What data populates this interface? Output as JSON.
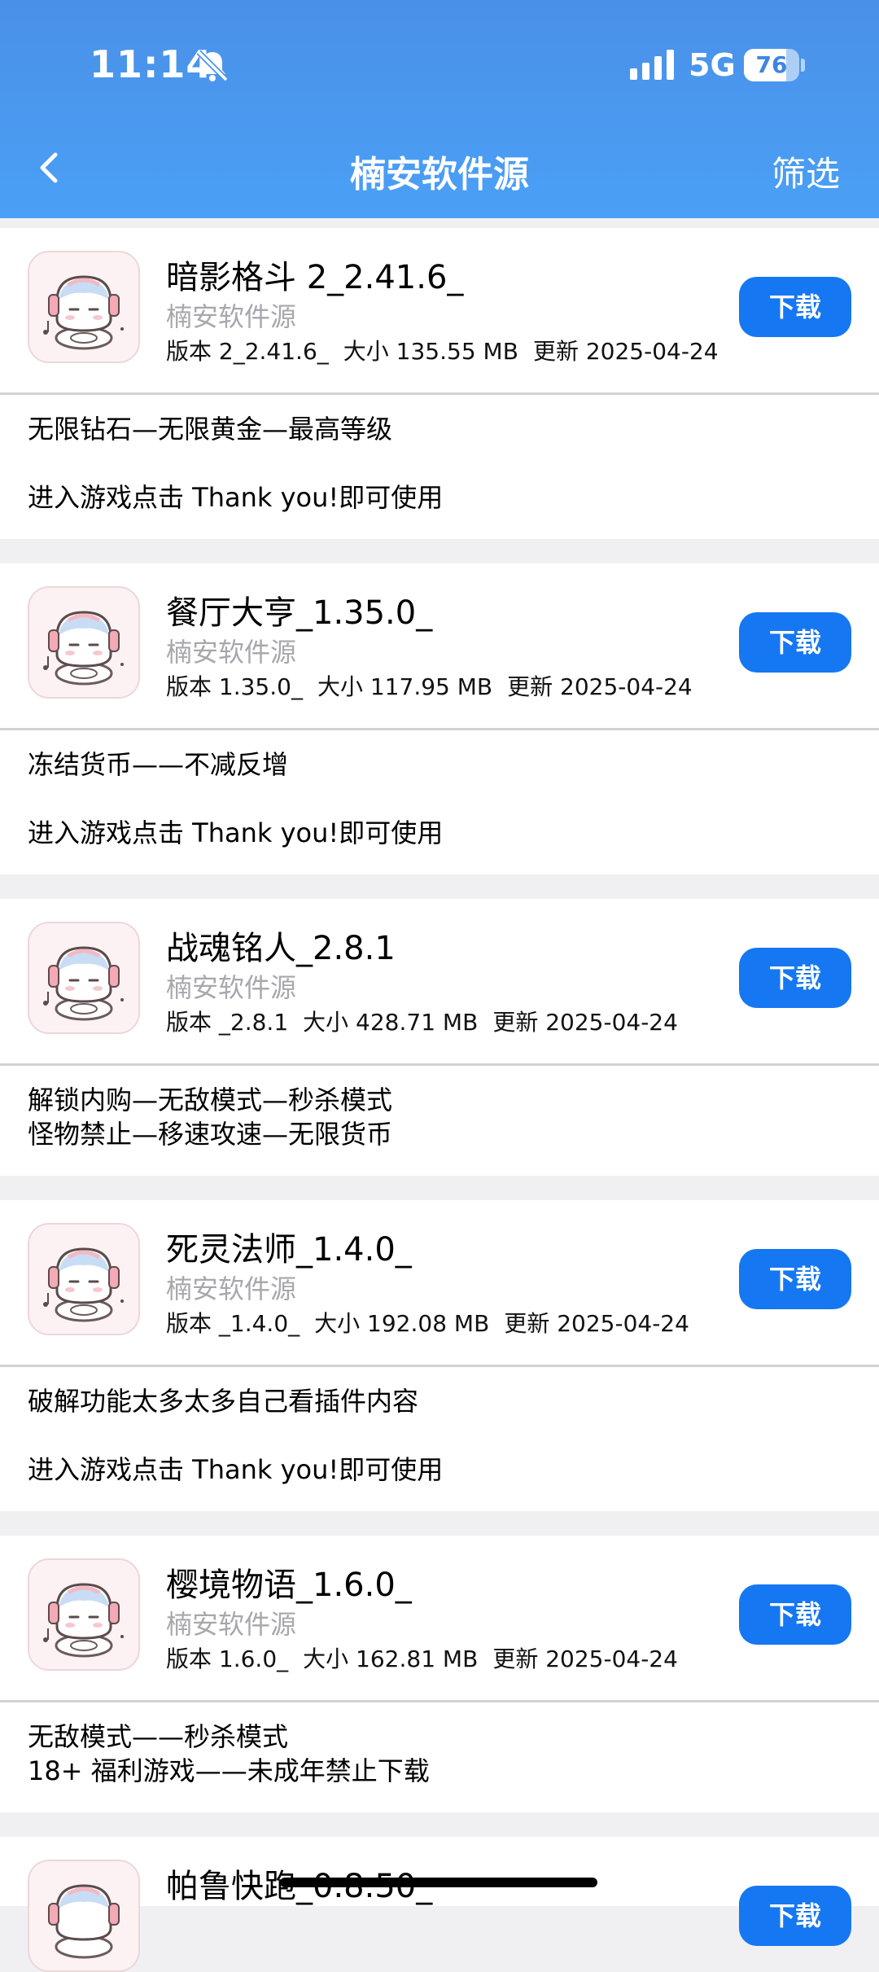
{
  "status_bar": {
    "time": "11:14",
    "network": "5G",
    "battery": "76",
    "battery_level": 0.76
  },
  "nav": {
    "title": "楠安软件源",
    "filter_label": "筛选"
  },
  "apps": [
    {
      "name": "暗影格斗 2_2.41.6_",
      "source": "楠安软件源",
      "version": "版本 2_2.41.6_",
      "size": "大小 135.55 MB",
      "updated": "更新 2025-04-24",
      "download_label": "下载",
      "desc": [
        "无限钻石—无限黄金—最高等级",
        "",
        "进入游戏点击 Thank you!即可使用"
      ]
    },
    {
      "name": "餐厅大亨_1.35.0_",
      "source": "楠安软件源",
      "version": "版本 1.35.0_",
      "size": "大小 117.95 MB",
      "updated": "更新 2025-04-24",
      "download_label": "下载",
      "desc": [
        "冻结货币——不减反增",
        "",
        "进入游戏点击 Thank you!即可使用"
      ]
    },
    {
      "name": "战魂铭人_2.8.1",
      "source": "楠安软件源",
      "version": "版本 _2.8.1",
      "size": "大小 428.71 MB",
      "updated": "更新 2025-04-24",
      "download_label": "下载",
      "desc": [
        "解锁内购—无敌模式—秒杀模式",
        "怪物禁止—移速攻速—无限货币"
      ]
    },
    {
      "name": "死灵法师_1.4.0_",
      "source": "楠安软件源",
      "version": "版本 _1.4.0_",
      "size": "大小 192.08 MB",
      "updated": "更新 2025-04-24",
      "download_label": "下载",
      "desc": [
        "破解功能太多太多自己看插件内容",
        "",
        "进入游戏点击 Thank you!即可使用"
      ]
    },
    {
      "name": "樱境物语_1.6.0_",
      "source": "楠安软件源",
      "version": "版本 1.6.0_",
      "size": "大小 162.81 MB",
      "updated": "更新 2025-04-24",
      "download_label": "下载",
      "desc": [
        "无敌模式——秒杀模式",
        "18+ 福利游戏——未成年禁止下载"
      ]
    },
    {
      "name": "帕鲁快跑_0.8.50_",
      "download_label": "下载"
    }
  ]
}
